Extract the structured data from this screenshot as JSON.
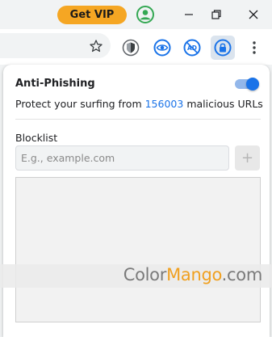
{
  "titlebar": {
    "vip_button_label": "Get VIP",
    "profile_icon": "profile-icon",
    "minimize_icon": "minimize-icon",
    "restore_icon": "restore-icon",
    "close_icon": "close-icon"
  },
  "toolbar": {
    "bookmark_icon": "star-icon",
    "extensions": [
      {
        "icon": "shield-mask-icon"
      },
      {
        "icon": "eye-protect-icon"
      },
      {
        "icon": "ad-block-icon"
      },
      {
        "icon": "anti-phishing-lock-icon",
        "active": true
      }
    ],
    "menu_icon": "more-vert-icon"
  },
  "popup": {
    "title": "Anti-Phishing",
    "toggle_on": true,
    "description_prefix": "Protect your surfing from",
    "malicious_count": "156003",
    "description_suffix": "malicious URLs",
    "blocklist_label": "Blocklist",
    "blocklist_placeholder": "E.g., example.com",
    "blocklist_value": "",
    "add_button_label": "+",
    "blocklist_items": []
  },
  "watermark": {
    "part1": "Color",
    "part2": "Mango",
    "part3": ".com"
  },
  "colors": {
    "accent": "#1a73e8",
    "vip": "#f5a623",
    "profile": "#34a853"
  }
}
